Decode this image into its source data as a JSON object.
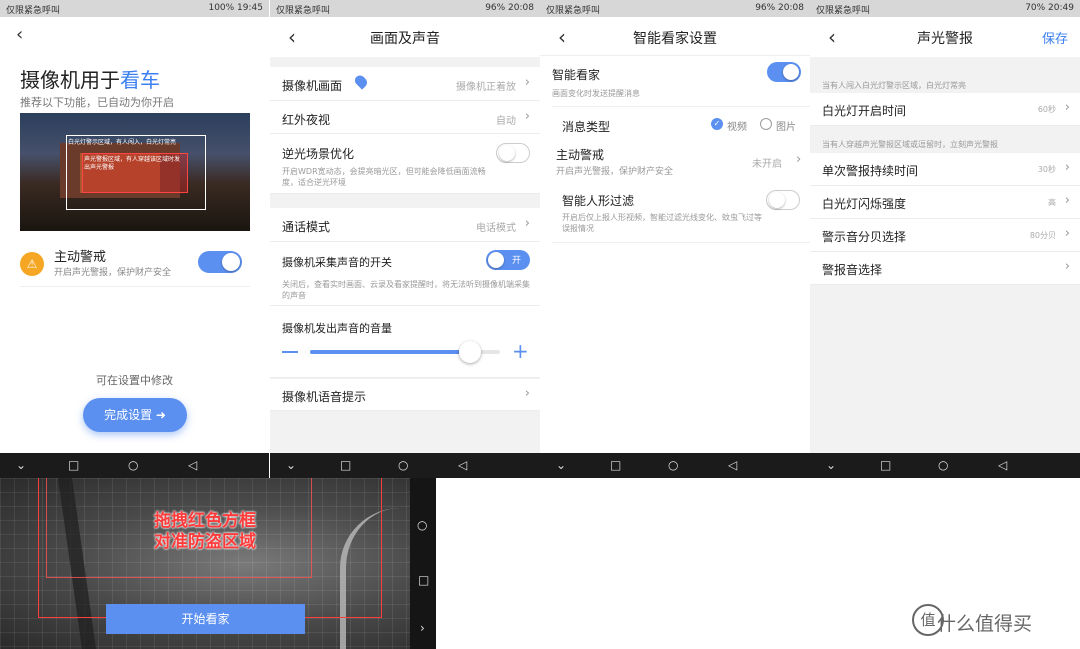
{
  "panel1": {
    "status_left": "仅限紧急呼叫",
    "status_right": "100% 19:45",
    "headline_prefix": "摄像机用于",
    "headline_highlight": "看车",
    "subline": "推荐以下功能，已自动为你开启",
    "preview_caption_1": "白光灯警示区域，有人闯入，白光灯常亮",
    "preview_caption_2": "声光警报区域，有人穿越该区域时发出声光警报",
    "alert_title": "主动警戒",
    "alert_sub": "开启声光警报，保护财产安全",
    "modify_hint": "可在设置中修改",
    "finish_button": "完成设置 ➜"
  },
  "panel2": {
    "status_left": "仅限紧急呼叫",
    "status_right": "96% 20:08",
    "title": "画面及声音",
    "rows": {
      "picture_label": "摄像机画面",
      "picture_value": "摄像机正着放",
      "night_label": "红外夜视",
      "night_value": "自动",
      "wdr_label": "逆光场景优化",
      "wdr_sub": "开启WDR宽动态，会提亮暗光区，但可能会降低画面流畅度，适合逆光环境",
      "call_label": "通话模式",
      "call_value": "电话模式",
      "mic_label": "摄像机采集声音的开关",
      "mic_toggle": "开",
      "mic_sub": "关闭后，查看实时画面、云录及看家提醒时，将无法听到摄像机端采集的声音",
      "volume_label": "摄像机发出声音的音量",
      "volume_level": 0.84,
      "voice_label": "摄像机语音提示"
    }
  },
  "panel3": {
    "status_left": "仅限紧急呼叫",
    "status_right": "96% 20:08",
    "title": "智能看家设置",
    "smart_label": "智能看家",
    "smart_sub": "画面变化时发送提醒消息",
    "msg_type_label": "消息类型",
    "msg_opt_video": "视频",
    "msg_opt_image": "图片",
    "active_label": "主动警戒",
    "active_sub": "开启声光警报，保护财产安全",
    "active_value": "未开启",
    "human_label": "智能人形过滤",
    "human_sub": "开启后仅上报人形视频，智能过滤光线变化、蚊虫飞过等误报情况"
  },
  "panel4": {
    "status_left": "仅限紧急呼叫",
    "status_right": "70% 20:49",
    "title": "声光警报",
    "save": "保存",
    "note1": "当有人闯入白光灯警示区域，白光灯常亮",
    "row1_label": "白光灯开启时间",
    "row1_value": "60秒",
    "note2": "当有人穿越声光警报区域或逗留时，立刻声光警报",
    "row2_label": "单次警报持续时间",
    "row2_value": "30秒",
    "row3_label": "白光灯闪烁强度",
    "row3_value": "高",
    "row4_label": "警示音分贝选择",
    "row4_value": "80分贝",
    "row5_label": "警报音选择"
  },
  "bottom": {
    "overlay_line1": "拖拽红色方框",
    "overlay_line2": "对准防盗区域",
    "start_button": "开始看家"
  },
  "watermark": "值 什么值得买",
  "colors": {
    "accent": "#5b8ff0",
    "alert_red": "#e53935",
    "status_bar": "#d7d7d7",
    "nav_bar": "#1b1b1b"
  }
}
